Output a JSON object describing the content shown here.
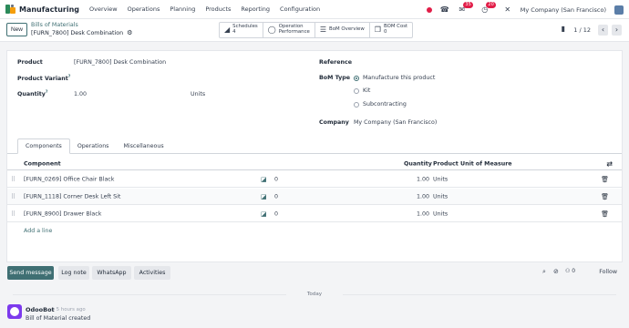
{
  "nav": {
    "brand": "Manufacturing",
    "menu": [
      "Overview",
      "Operations",
      "Planning",
      "Products",
      "Reporting",
      "Configuration"
    ],
    "messages_badge": "35",
    "activities_badge": "20",
    "company": "My Company (San Francisco)"
  },
  "control": {
    "new_label": "New",
    "breadcrumb_parent": "Bills of Materials",
    "breadcrumb_current": "[FURN_7800] Desk Combination",
    "smart_buttons": [
      {
        "icon": "area-chart-icon",
        "label1": "Schedules",
        "label2": "4"
      },
      {
        "icon": "circle-icon",
        "label1": "Operation",
        "label2": "Performance"
      },
      {
        "icon": "list-icon",
        "label1": "BoM Overview",
        "label2": ""
      },
      {
        "icon": "cube-icon",
        "label1": "BOM Cost",
        "label2": "0"
      }
    ],
    "pager": "1 / 12"
  },
  "form": {
    "product_label": "Product",
    "product_value": "[FURN_7800] Desk Combination",
    "variant_label": "Product Variant",
    "variant_help": "?",
    "quantity_label": "Quantity",
    "quantity_help": "?",
    "quantity_value": "1.00",
    "quantity_uom": "Units",
    "reference_label": "Reference",
    "bom_type_label": "BoM Type",
    "bom_type_options": [
      "Manufacture this product",
      "Kit",
      "Subcontracting"
    ],
    "bom_type_selected": "Manufacture this product",
    "company_label": "Company",
    "company_value": "My Company (San Francisco)"
  },
  "tabs": [
    "Components",
    "Operations",
    "Miscellaneous"
  ],
  "table": {
    "headers": {
      "component": "Component",
      "quantity": "Quantity",
      "uom": "Product Unit of Measure"
    },
    "rows": [
      {
        "component": "[FURN_0269] Office Chair Black",
        "forecast": "0",
        "quantity": "1.00",
        "uom": "Units"
      },
      {
        "component": "[FURN_1118] Corner Desk Left Sit",
        "forecast": "0",
        "quantity": "1.00",
        "uom": "Units"
      },
      {
        "component": "[FURN_8900] Drawer Black",
        "forecast": "0",
        "quantity": "1.00",
        "uom": "Units"
      }
    ],
    "add_line": "Add a line"
  },
  "chatter": {
    "send_message": "Send message",
    "log_note": "Log note",
    "whatsapp": "WhatsApp",
    "activities": "Activities",
    "attachment_count": "0",
    "follow": "Follow",
    "today": "Today",
    "message": {
      "author": "OdooBot",
      "time": "- 5 hours ago",
      "body": "Bill of Material created"
    }
  },
  "colors": {
    "brand": "#3f6f73",
    "badge": "#e11d48",
    "avatar": "#7c3aed"
  }
}
